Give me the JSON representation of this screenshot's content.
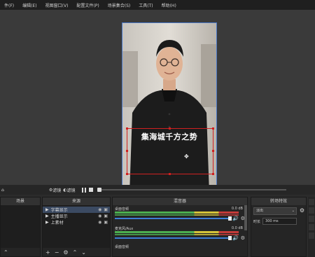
{
  "menu": [
    "件(F)",
    "编辑(E)",
    "视图窗口(V)",
    "配置文件(P)",
    "场景集合(S)",
    "工具(T)",
    "帮助(H)"
  ],
  "video": {
    "caption": "集海城千方之势"
  },
  "controls": {
    "scene_filters_label": "滤镜",
    "source_filters_label": "滤镜"
  },
  "docks": {
    "scenes": {
      "title": "场景"
    },
    "sources": {
      "title": "来源",
      "items": [
        {
          "name": "字幕显示",
          "visible": true,
          "locked": false,
          "selected": true
        },
        {
          "name": "主播显示",
          "visible": true,
          "locked": false,
          "selected": false
        },
        {
          "name": "上素材",
          "visible": true,
          "locked": false,
          "selected": false
        }
      ]
    },
    "mixer": {
      "title": "混音器",
      "channels": [
        {
          "name": "桌面音频",
          "db": "0.0 dB",
          "level": 0.92
        },
        {
          "name": "麦克风/Aux",
          "db": "0.0 dB",
          "level": 0.92
        },
        {
          "name": "桌面音频",
          "db": "",
          "level": 0
        }
      ]
    },
    "transitions": {
      "title": "转场特效",
      "current": "淡出",
      "duration_label": "时长",
      "duration_value": "300 ms"
    }
  },
  "colors": {
    "accent": "#4a78c8",
    "selection": "#d02020",
    "meter_green": "#4caf50",
    "meter_red": "#c43a3a"
  }
}
